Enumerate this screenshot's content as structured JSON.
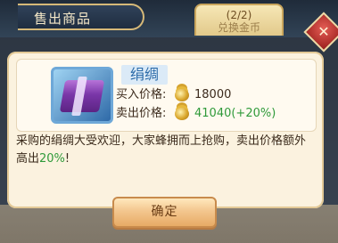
{
  "header": {
    "title": "售出商品",
    "tab_count": "(2/2)",
    "tab_label": "兑换金币"
  },
  "dialog": {
    "item_name": "绢绸",
    "buy_label": "买入价格:",
    "buy_value": "18000",
    "sell_label": "卖出价格:",
    "sell_value": "41040(+20%)",
    "description_main": "采购的绢绸大受欢迎，大家蜂拥而上抢购，卖出价格额外高出",
    "description_pct": "20%",
    "description_end": "!",
    "confirm_label": "确定"
  },
  "icons": {
    "item": "silk-bundle-icon",
    "currency": "coin-stack-icon",
    "close": "close-icon"
  },
  "colors": {
    "accent_green": "#2f9a3a",
    "name_blue": "#2a6aa8",
    "panel": "#fbf2df"
  }
}
